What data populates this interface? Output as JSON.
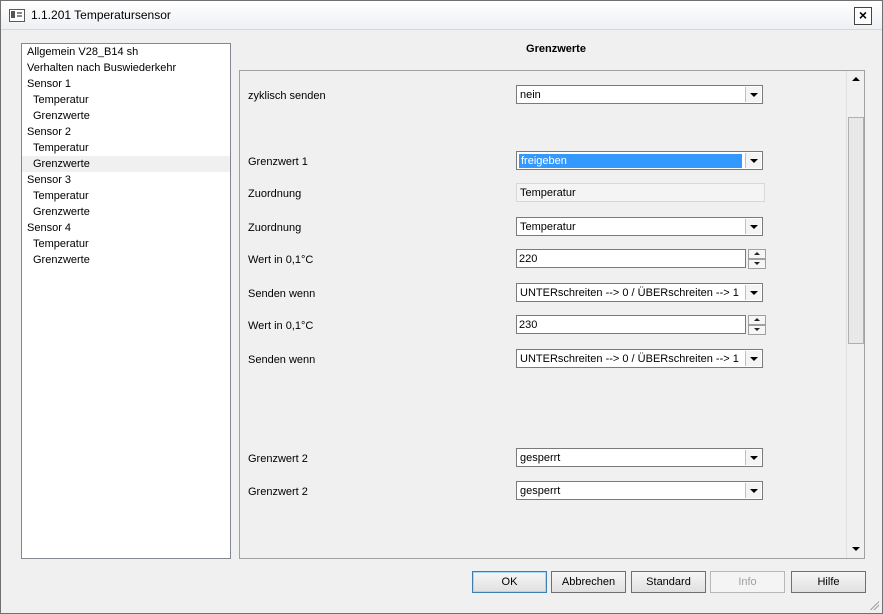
{
  "window": {
    "title": "1.1.201 Temperatursensor"
  },
  "tree": {
    "items": [
      {
        "label": "Allgemein V28_B14 sh",
        "level": 0,
        "selected": false
      },
      {
        "label": "Verhalten nach Buswiederkehr",
        "level": 0,
        "selected": false
      },
      {
        "label": "Sensor 1",
        "level": 0,
        "selected": false
      },
      {
        "label": "Temperatur",
        "level": 1,
        "selected": false
      },
      {
        "label": "Grenzwerte",
        "level": 1,
        "selected": false
      },
      {
        "label": "Sensor 2",
        "level": 0,
        "selected": false
      },
      {
        "label": "Temperatur",
        "level": 1,
        "selected": false
      },
      {
        "label": "Grenzwerte",
        "level": 1,
        "selected": true
      },
      {
        "label": "Sensor 3",
        "level": 0,
        "selected": false
      },
      {
        "label": "Temperatur",
        "level": 1,
        "selected": false
      },
      {
        "label": "Grenzwerte",
        "level": 1,
        "selected": false
      },
      {
        "label": "Sensor 4",
        "level": 0,
        "selected": false
      },
      {
        "label": "Temperatur",
        "level": 1,
        "selected": false
      },
      {
        "label": "Grenzwerte",
        "level": 1,
        "selected": false
      }
    ]
  },
  "section": {
    "title": "Grenzwerte"
  },
  "params": {
    "zyklisch": {
      "label": "zyklisch senden",
      "value": "nein"
    },
    "grenzwert1": {
      "label": "Grenzwert 1",
      "value": "freigeben"
    },
    "zuordnung_ro": {
      "label": "Zuordnung",
      "value": "Temperatur"
    },
    "zuordnung": {
      "label": "Zuordnung",
      "value": "Temperatur"
    },
    "wert1": {
      "label": "Wert in 0,1°C",
      "value": "220"
    },
    "senden1": {
      "label": "Senden wenn",
      "value": "UNTERschreiten --> 0 / ÜBERschreiten --> 1"
    },
    "wert2": {
      "label": "Wert in 0,1°C",
      "value": "230"
    },
    "senden2": {
      "label": "Senden wenn",
      "value": "UNTERschreiten --> 0 / ÜBERschreiten --> 1"
    },
    "grenzwert2a": {
      "label": "Grenzwert 2",
      "value": "gesperrt"
    },
    "grenzwert2b": {
      "label": "Grenzwert 2",
      "value": "gesperrt"
    }
  },
  "buttons": {
    "ok": "OK",
    "abbrechen": "Abbrechen",
    "standard": "Standard",
    "info": "Info",
    "hilfe": "Hilfe"
  },
  "colors": {
    "selection": "#3399ff",
    "window_bg": "#f0f0f0"
  }
}
